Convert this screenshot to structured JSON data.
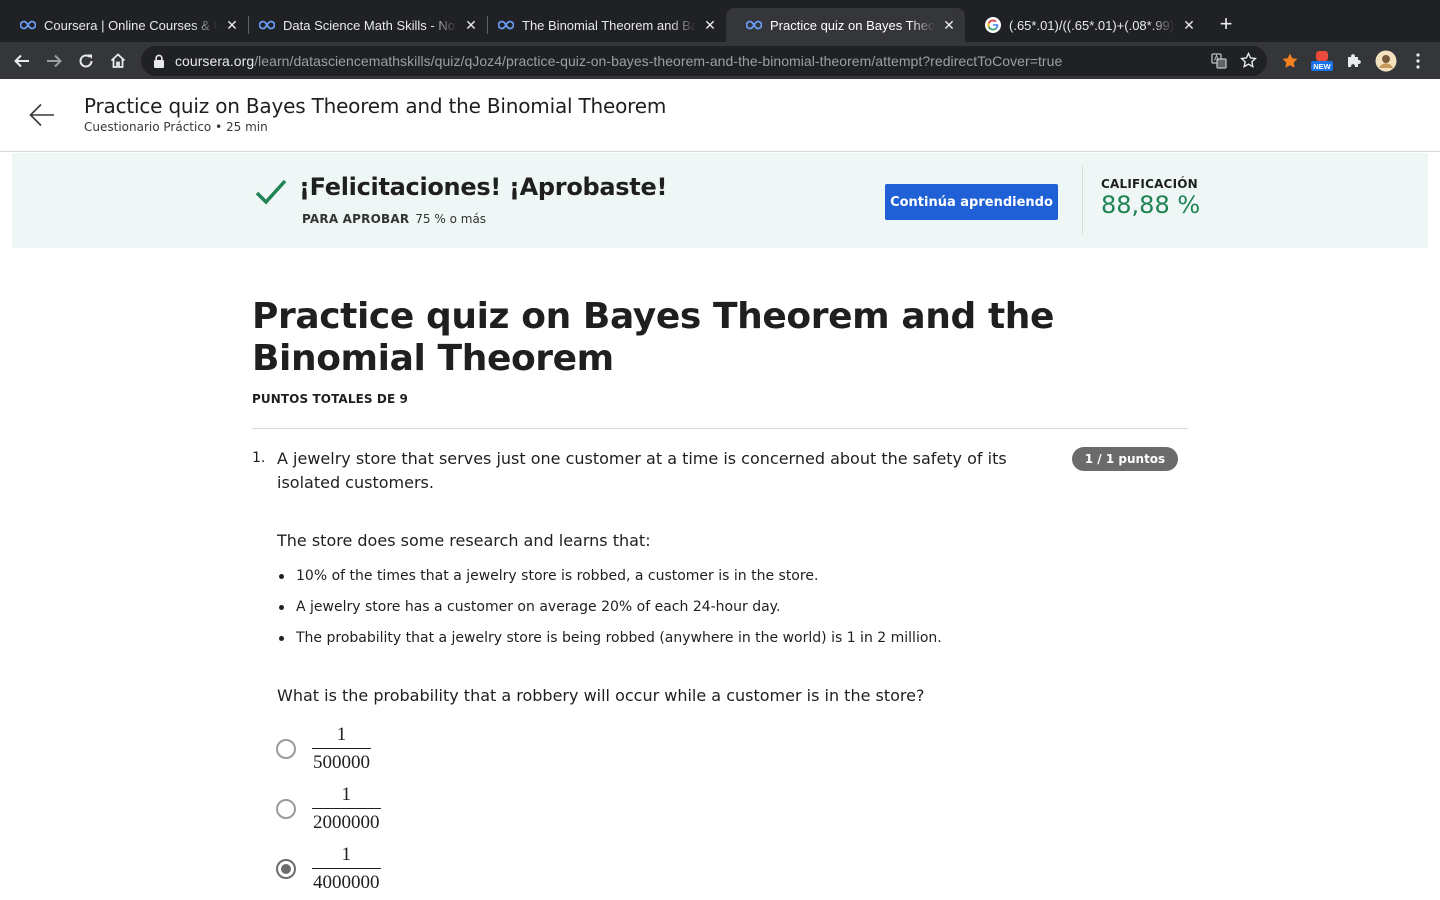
{
  "browser": {
    "tabs": [
      {
        "title": "Coursera | Online Courses & Credentials",
        "favicon": "coursera-icon",
        "active": false
      },
      {
        "title": "Data Science Math Skills - Notas",
        "favicon": "coursera-icon",
        "active": false
      },
      {
        "title": "The Binomial Theorem and Bayes",
        "favicon": "coursera-icon",
        "active": false
      },
      {
        "title": "Practice quiz on Bayes Theorem",
        "favicon": "coursera-icon",
        "active": true
      },
      {
        "title": "(.65*.01)/((.65*.01)+(.08*.99))",
        "favicon": "google-icon",
        "active": false
      }
    ],
    "url_host": "coursera.org",
    "url_path": "/learn/datasciencemathskills/quiz/qJoz4/practice-quiz-on-bayes-theorem-and-the-binomial-theorem/attempt?redirectToCover=true",
    "extension_badge": "NEW"
  },
  "header": {
    "title": "Practice quiz on Bayes Theorem and the Binomial Theorem",
    "subtitle": "Cuestionario Práctico • 25 min"
  },
  "banner": {
    "message": "¡Felicitaciones! ¡Aprobaste!",
    "pass_label": "PARA APROBAR",
    "pass_value": "75 % o más",
    "continue_button": "Continúa aprendiendo",
    "grade_label": "CALIFICACIÓN",
    "grade_value": "88,88 %",
    "accent_color": "#1f8354",
    "button_color": "#1f60d6"
  },
  "quiz": {
    "title": "Practice quiz on Bayes Theorem and the Binomial Theorem",
    "points_total": "PUNTOS TOTALES DE 9",
    "questions": [
      {
        "number": "1.",
        "text": "A jewelry store that serves just one customer at a time is concerned about the safety of its isolated customers.",
        "score": "1 / 1 puntos",
        "intro": "The store does some research and learns that:",
        "facts": [
          "10% of the times that a jewelry store is robbed, a customer is in the store.",
          "A jewelry store has a customer on average 20% of each 24-hour day.",
          "The probability that a jewelry store is being robbed (anywhere in the world) is 1 in 2 million."
        ],
        "ask": "What is the probability that a robbery will occur while a customer is in the store?",
        "options": [
          {
            "numerator": "1",
            "denominator": "500000",
            "selected": false
          },
          {
            "numerator": "1",
            "denominator": "2000000",
            "selected": false
          },
          {
            "numerator": "1",
            "denominator": "4000000",
            "selected": true
          }
        ]
      }
    ]
  }
}
